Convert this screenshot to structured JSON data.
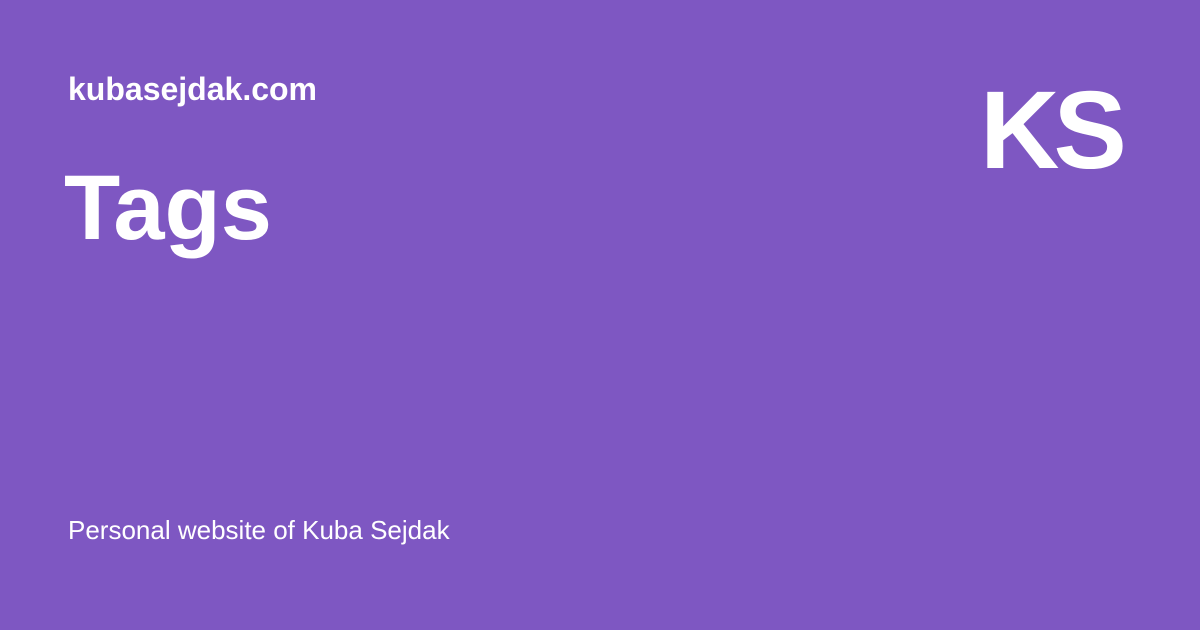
{
  "site": {
    "name": "kubasejdak.com",
    "logo": "KS",
    "tagline": "Personal website of Kuba Sejdak"
  },
  "page": {
    "title": "Tags"
  },
  "colors": {
    "background": "#7e57c2",
    "text": "#ffffff"
  }
}
